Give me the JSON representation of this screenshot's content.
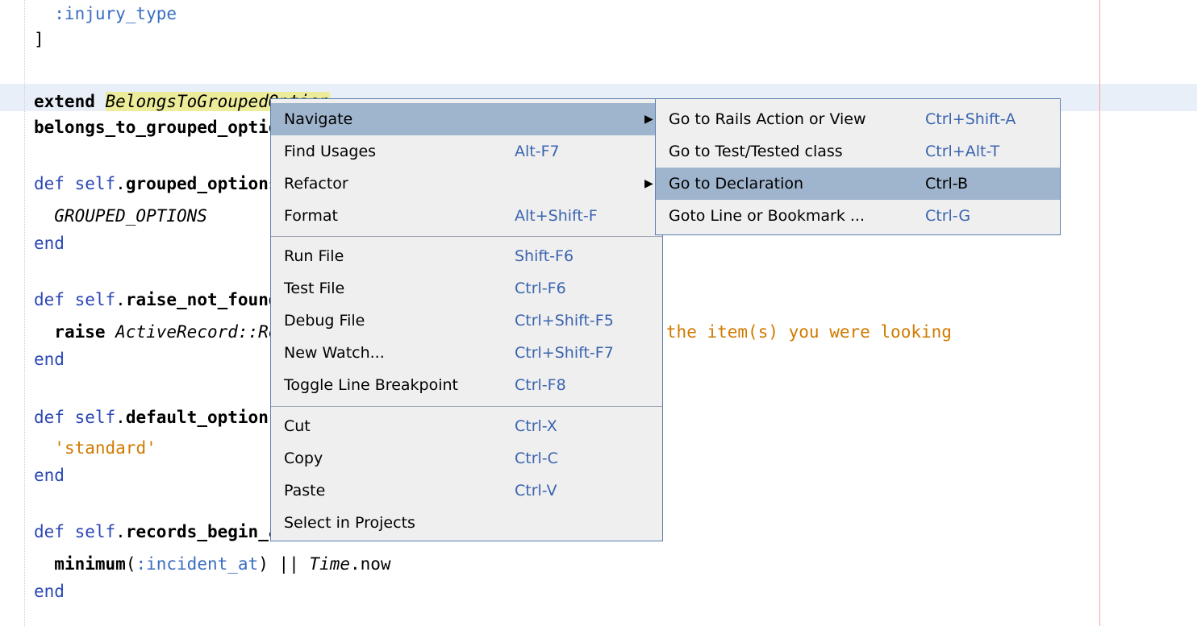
{
  "editor": {
    "lines": [
      [
        {
          "t": "  :injury_type",
          "c": "sym"
        }
      ],
      [
        {
          "t": "]",
          "c": "plain"
        }
      ],
      [
        {
          "t": "extend",
          "c": "kw"
        },
        {
          "t": " ",
          "c": "plain"
        },
        {
          "t": "BelongsToGroupedOption",
          "c": "const-hl"
        }
      ],
      [
        {
          "t": "belongs_to_grouped_option",
          "c": "kw"
        }
      ],
      [
        {
          "t": "def",
          "c": "kwblue"
        },
        {
          "t": " ",
          "c": "plain"
        },
        {
          "t": "self",
          "c": "kwblue"
        },
        {
          "t": ".",
          "c": "plain"
        },
        {
          "t": "grouped_options",
          "c": "kw"
        }
      ],
      [
        {
          "t": "  GROUPED_OPTIONS",
          "c": "const"
        }
      ],
      [
        {
          "t": "end",
          "c": "kwblue"
        }
      ],
      [
        {
          "t": "def",
          "c": "kwblue"
        },
        {
          "t": " ",
          "c": "plain"
        },
        {
          "t": "self",
          "c": "kwblue"
        },
        {
          "t": ".",
          "c": "plain"
        },
        {
          "t": "raise_not_found",
          "c": "kw"
        }
      ],
      [
        {
          "t": "  ",
          "c": "plain"
        },
        {
          "t": "raise",
          "c": "kw"
        },
        {
          "t": " ",
          "c": "plain"
        },
        {
          "t": "ActiveRecord::RecordNotFound, 'We were unab",
          "c": "const"
        },
        {
          "t": "le to find the item(s) you were looking",
          "c": "str"
        }
      ],
      [
        {
          "t": "end",
          "c": "kwblue"
        }
      ],
      [
        {
          "t": "def",
          "c": "kwblue"
        },
        {
          "t": " ",
          "c": "plain"
        },
        {
          "t": "self",
          "c": "kwblue"
        },
        {
          "t": ".",
          "c": "plain"
        },
        {
          "t": "default_option",
          "c": "kw"
        }
      ],
      [
        {
          "t": "  ",
          "c": "plain"
        },
        {
          "t": "'standard'",
          "c": "str"
        }
      ],
      [
        {
          "t": "end",
          "c": "kwblue"
        }
      ],
      [
        {
          "t": "def",
          "c": "kwblue"
        },
        {
          "t": " ",
          "c": "plain"
        },
        {
          "t": "self",
          "c": "kwblue"
        },
        {
          "t": ".",
          "c": "plain"
        },
        {
          "t": "records_begin_at",
          "c": "kw"
        }
      ],
      [
        {
          "t": "  ",
          "c": "plain"
        },
        {
          "t": "minimum",
          "c": "kw"
        },
        {
          "t": "(",
          "c": "plain"
        },
        {
          "t": ":incident_at",
          "c": "sym"
        },
        {
          "t": ") || ",
          "c": "plain"
        },
        {
          "t": "Time",
          "c": "const"
        },
        {
          "t": ".now",
          "c": "plain"
        }
      ],
      [
        {
          "t": "end",
          "c": "kwblue"
        }
      ]
    ]
  },
  "context_menu": {
    "items": [
      {
        "label": "Navigate",
        "shortcut": "",
        "submenu": true,
        "active": true
      },
      {
        "label": "Find Usages",
        "shortcut": "Alt-F7"
      },
      {
        "label": "Refactor",
        "shortcut": "",
        "submenu": true
      },
      {
        "label": "Format",
        "shortcut": "Alt+Shift-F"
      },
      {
        "label": "Run File",
        "shortcut": "Shift-F6"
      },
      {
        "label": "Test File",
        "shortcut": "Ctrl-F6"
      },
      {
        "label": "Debug File",
        "shortcut": "Ctrl+Shift-F5"
      },
      {
        "label": "New Watch...",
        "shortcut": "Ctrl+Shift-F7"
      },
      {
        "label": "Toggle Line Breakpoint",
        "shortcut": "Ctrl-F8"
      },
      {
        "label": "Cut",
        "shortcut": "Ctrl-X"
      },
      {
        "label": "Copy",
        "shortcut": "Ctrl-C"
      },
      {
        "label": "Paste",
        "shortcut": "Ctrl-V"
      },
      {
        "label": "Select in Projects",
        "shortcut": ""
      }
    ]
  },
  "submenu": {
    "items": [
      {
        "label": "Go to Rails Action or View",
        "shortcut": "Ctrl+Shift-A"
      },
      {
        "label": "Go to Test/Tested class",
        "shortcut": "Ctrl+Alt-T"
      },
      {
        "label": "Go to Declaration",
        "shortcut": "Ctrl-B",
        "active": true
      },
      {
        "label": "Goto Line or Bookmark ...",
        "shortcut": "Ctrl-G"
      }
    ]
  },
  "icons": {
    "submenu_arrow": "triangle-right-icon"
  },
  "colors": {
    "menu_bg": "#efefef",
    "menu_highlight": "#9fb4cd",
    "shortcut": "#3b64b0",
    "string": "#d07a00",
    "symbol": "#3a6ec1",
    "margin_line": "#f4a3a3"
  }
}
